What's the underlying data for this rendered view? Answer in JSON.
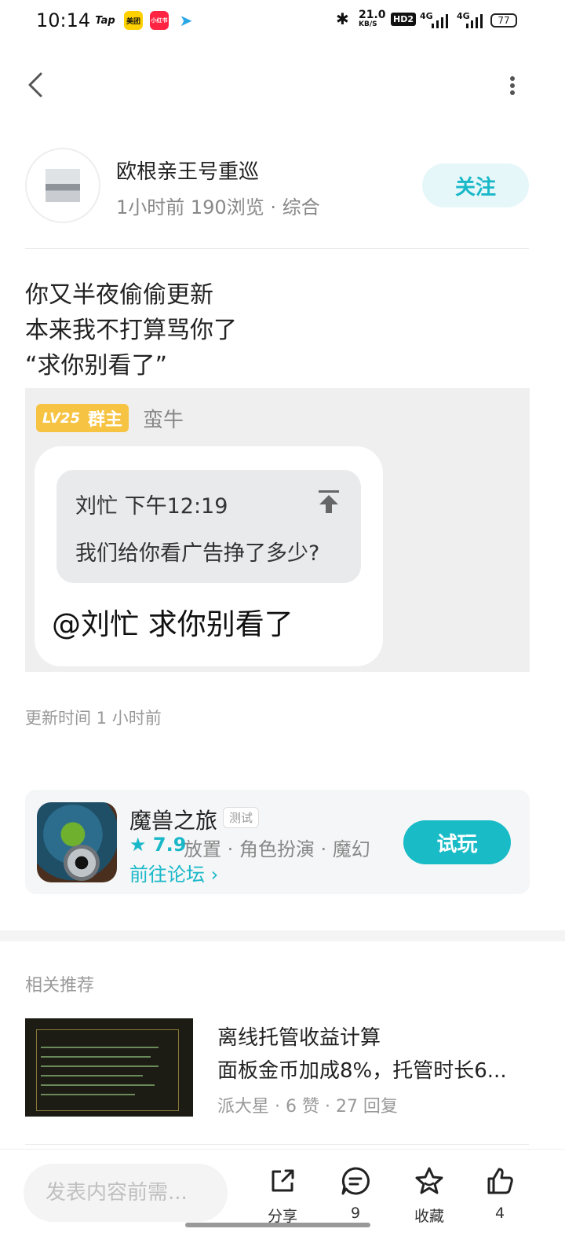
{
  "status_bar": {
    "time": "10:14",
    "app_icons": [
      "Tap",
      "美团",
      "小红书",
      "plane"
    ],
    "net_speed_top": "21.0",
    "net_speed_unit": "KB/S",
    "hd": "HD2",
    "signal1": "4G",
    "signal2": "4G",
    "battery": "77"
  },
  "author": {
    "name": "欧根亲王号重巡",
    "meta": "1小时前  190浏览 · 综合",
    "follow_label": "关注"
  },
  "post": {
    "lines": [
      "你又半夜偷偷更新",
      "本来我不打算骂你了",
      "“求你别看了”"
    ],
    "image": {
      "badge_level": "LV25",
      "badge_title": "群主",
      "nickname": "蛮牛",
      "quote_header": "刘忙  下午12:19",
      "quote_text": "我们给你看广告挣了多少?",
      "reply_text": "@刘忙  求你别看了"
    },
    "updated": "更新时间 1 小时前"
  },
  "game_card": {
    "name": "魔兽之旅",
    "tag": "测试",
    "rating": "7.9",
    "categories": "放置 · 角色扮演 · 魔幻",
    "forum_link": "前往论坛",
    "try_label": "试玩"
  },
  "recommend": {
    "section_title": "相关推荐",
    "item": {
      "title_line1": "离线托管收益计算",
      "title_line2": "面板金币加成8%，托管时长6...",
      "meta": "派大星 · 6 赞 · 27 回复"
    }
  },
  "bottom_bar": {
    "input_placeholder": "发表内容前需...",
    "share_label": "分享",
    "comment_count": "9",
    "favorite_label": "收藏",
    "like_count": "4"
  }
}
